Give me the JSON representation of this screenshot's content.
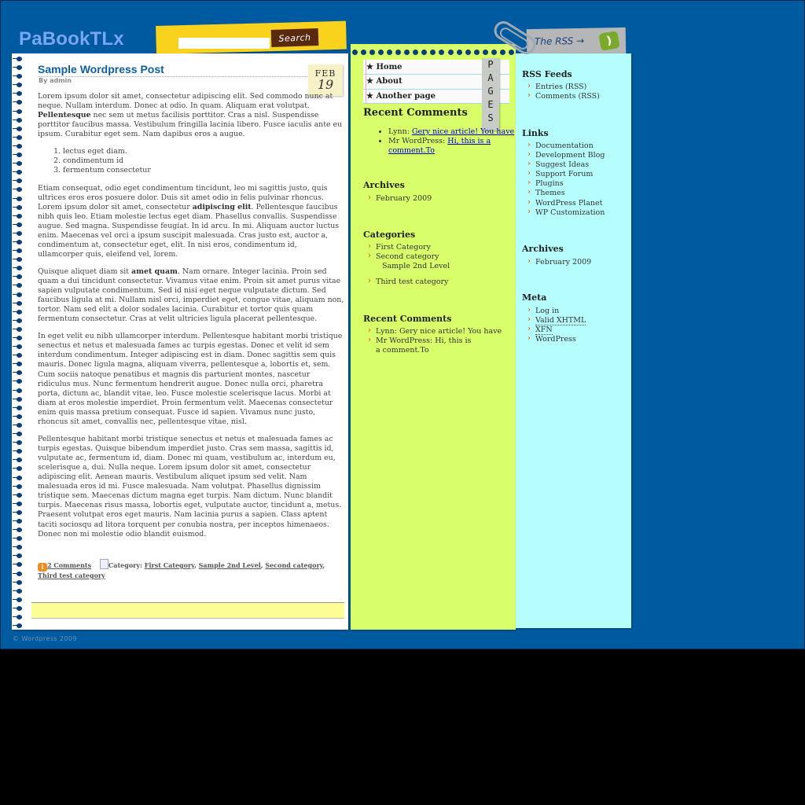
{
  "site": {
    "title": "PaBookTLx",
    "footer": "© Wordpress 2009"
  },
  "search": {
    "placeholder": "",
    "value": "",
    "button_label": "Search"
  },
  "post": {
    "title": "Sample Wordpress Post",
    "author": "By admin",
    "date": {
      "month": "FEB",
      "day": "19"
    },
    "paragraphs": [
      {
        "pre": "Lorem ipsum dolor sit amet, consectetur adipiscing elit. Sed commodo nunc at neque. Nullam interdum. Donec at odio. In quam. Aliquam erat volutpat. ",
        "bold": "Pellentesque",
        "post": " nec sem ut metus facilisis porttitor. Cras a nisl. Suspendisse porttitor faucibus massa. Vestibulum fringilla lacinia libero. Fusce iaculis ante eu ipsum. Curabitur eget sem. Nam dapibus eros a augue."
      },
      {
        "pre": "Etiam consequat, odio eget condimentum tincidunt, leo mi sagittis justo, quis ultrices eros eros posuere dolor. Duis sit amet odio in felis pulvinar rhoncus. Lorem ipsum dolor sit amet, consectetur ",
        "bold": "adipiscing elit",
        "post": ". Pellentesque faucibus nibh quis leo. Etiam molestie lectus eget diam. Phasellus convallis. Suspendisse augue. Sed magna. Suspendisse feugiat. In id arcu. In mi. Aliquam auctor luctus enim. Maecenas vel orci a ipsum suscipit malesuada. Cras justo est, auctor a, condimentum at, consectetur eget, elit. In nisi eros, condimentum id, ullamcorper quis, eleifend vel, lorem."
      },
      {
        "pre": "Quisque aliquet diam sit ",
        "bold": "amet quam",
        "post": ". Nam ornare. Integer lacinia. Proin sed quam a dui tincidunt consectetur. Vivamus vitae enim. Proin sit amet purus vitae sapien vulputate condimentum. Sed id nisi eget neque vulputate dictum. Sed faucibus ligula at mi. Nullam nisl orci, imperdiet eget, congue vitae, aliquam non, tortor. Nam sed elit a dolor sodales lacinia. Curabitur et tortor quis quam fermentum consectetur. Cras at velit ultricies ligula placerat pellentesque."
      },
      {
        "pre": "In eget velit eu nibh ullamcorper interdum. Pellentesque habitant morbi tristique senectus et netus et malesuada fames ac turpis egestas. Donec et velit id sem interdum condimentum. Integer adipiscing est in diam. Donec sagittis sem quis mauris. Donec ligula magna, aliquam viverra, pellentesque a, lobortis et, sem. Cum sociis natoque penatibus et magnis dis parturient montes, nascetur ridiculus mus. Nunc fermentum hendrerit augue. Donec nulla orci, pharetra porta, dictum ac, blandit vitae, leo. Fusce molestie scelerisque lacus. Morbi at diam at eros molestie imperdiet. Proin fermentum velit. Maecenas consectetur enim quis massa pretium consequat. Fusce id sapien. Vivamus nunc justo, rhoncus sit amet, convallis nec, pellentesque vitae, nisl.",
        "bold": "",
        "post": ""
      },
      {
        "pre": "Pellentesque habitant morbi tristique senectus et netus et malesuada fames ac turpis egestas. Quisque bibendum imperdiet justo. Cras sem massa, sagittis id, vulputate ac, fermentum id, diam. Donec mi quam, vestibulum ac, interdum eu, scelerisque a, dui. Nulla neque. Lorem ipsum dolor sit amet, consectetur adipiscing elit. Aenean mauris. Vestibulum aliquet ipsum sed velit. Nam malesuada eros id mi. Fusce malesuada. Nam volutpat. Phasellus dignissim tristique sem. Maecenas dictum magna eget turpis. Nam dictum. Nunc blandit turpis. Maecenas risus massa, lobortis eget, vulputate auctor, tincidunt a, metus. Praesent volutpat eros eget mauris. Nam lacinia purus a sapien. Class aptent taciti sociosqu ad litora torquent per conubia nostra, per inceptos himenaeos. Donec non mi molestie odio blandit euismod.",
        "bold": "",
        "post": ""
      }
    ],
    "list": [
      "lectus eget diam.",
      "condimentum id",
      "fermentum consectetur"
    ],
    "meta": {
      "comments": "2 Comments",
      "category_label": "Category:",
      "categories": [
        "First Category",
        "Sample 2nd Level",
        "Second category",
        "Third test category"
      ]
    }
  },
  "pages": {
    "tab_letters": [
      "P",
      "A",
      "G",
      "E",
      "S"
    ],
    "items": [
      "Home",
      "About",
      "Another page"
    ]
  },
  "green_sidebar": {
    "recent_comments_1": {
      "title": "Recent Comments",
      "items": [
        {
          "author": "Lynn: ",
          "text": "Gery nice article! You have"
        },
        {
          "author": "Mr WordPress: ",
          "text": "Hi, this is a comment.To"
        }
      ]
    },
    "archives": {
      "title": "Archives",
      "items": [
        "February 2009"
      ]
    },
    "categories": {
      "title": "Categories",
      "items": [
        "First Category",
        "Second category"
      ],
      "sub": "Sample 2nd Level",
      "after": "Third test category"
    },
    "recent_comments_2": {
      "title": "Recent Comments",
      "items": [
        "Lynn: Gery nice article! You have",
        "Mr WordPress: Hi, this is a comment.To"
      ]
    }
  },
  "rss": {
    "tag_label": "The RSS →"
  },
  "cyan_sidebar": {
    "rss_feeds": {
      "title": "RSS Feeds",
      "items": [
        "Entries (RSS)",
        "Comments (RSS)"
      ]
    },
    "links": {
      "title": "Links",
      "items": [
        "Documentation",
        "Development Blog",
        "Suggest Ideas",
        "Support Forum",
        "Plugins",
        "Themes",
        "WordPress Planet",
        "WP Customization"
      ]
    },
    "archives": {
      "title": "Archives",
      "items": [
        "February 2009"
      ]
    },
    "meta": {
      "title": "Meta",
      "items": [
        "Log in",
        "Valid XHTML",
        "XFN",
        "WordPress"
      ]
    }
  },
  "colors": {
    "background": "#005aa0",
    "green": "#d8fe6a",
    "cyan": "#b6fefe",
    "yellow": "#f9d21e",
    "title_blue": "#0d5f9e",
    "bullet_orange": "#e07010"
  }
}
